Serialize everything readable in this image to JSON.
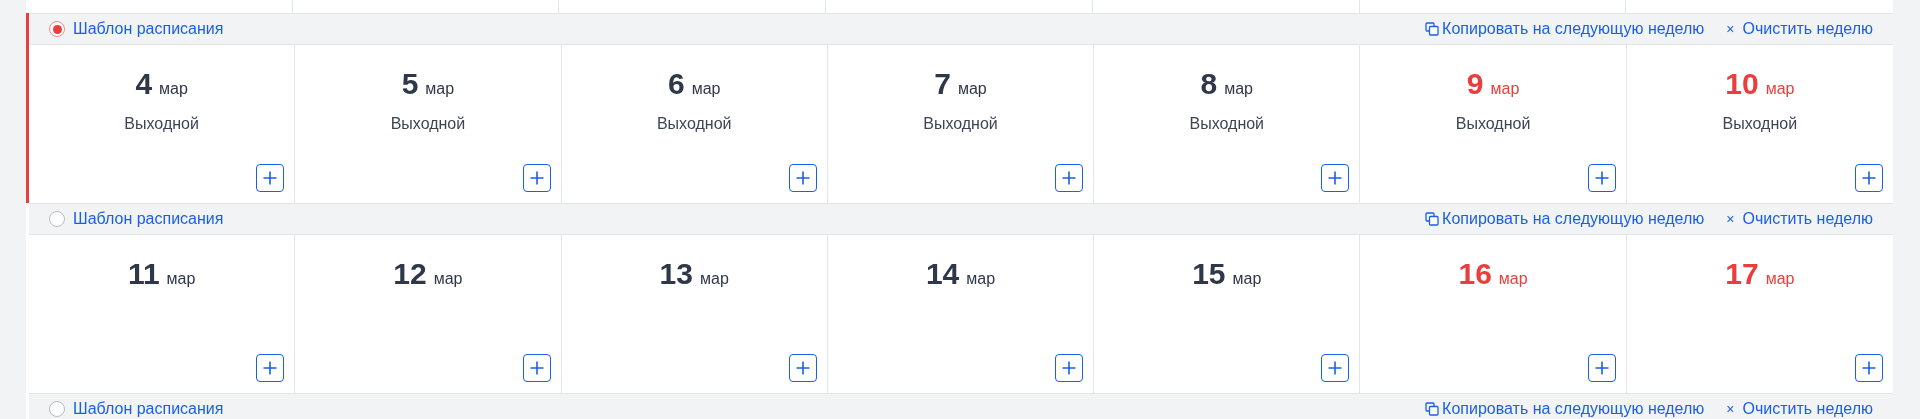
{
  "weeks": [
    {
      "selected": true,
      "template_label": "Шаблон расписания",
      "copy_label": "Копировать на следующую неделю",
      "clear_mark": "×",
      "clear_label": "Очистить неделю",
      "days": [
        {
          "day": "4",
          "month": "мар",
          "weekend": false,
          "note": "Выходной"
        },
        {
          "day": "5",
          "month": "мар",
          "weekend": false,
          "note": "Выходной"
        },
        {
          "day": "6",
          "month": "мар",
          "weekend": false,
          "note": "Выходной"
        },
        {
          "day": "7",
          "month": "мар",
          "weekend": false,
          "note": "Выходной"
        },
        {
          "day": "8",
          "month": "мар",
          "weekend": false,
          "note": "Выходной"
        },
        {
          "day": "9",
          "month": "мар",
          "weekend": true,
          "note": "Выходной"
        },
        {
          "day": "10",
          "month": "мар",
          "weekend": true,
          "note": "Выходной"
        }
      ]
    },
    {
      "selected": false,
      "template_label": "Шаблон расписания",
      "copy_label": "Копировать на следующую неделю",
      "clear_mark": "×",
      "clear_label": "Очистить неделю",
      "days": [
        {
          "day": "11",
          "month": "мар",
          "weekend": false
        },
        {
          "day": "12",
          "month": "мар",
          "weekend": false
        },
        {
          "day": "13",
          "month": "мар",
          "weekend": false
        },
        {
          "day": "14",
          "month": "мар",
          "weekend": false
        },
        {
          "day": "15",
          "month": "мар",
          "weekend": false
        },
        {
          "day": "16",
          "month": "мар",
          "weekend": true
        },
        {
          "day": "17",
          "month": "мар",
          "weekend": true
        }
      ]
    },
    {
      "selected": false,
      "template_label": "Шаблон расписания",
      "copy_label": "Копировать на следующую неделю",
      "clear_mark": "×",
      "clear_label": "Очистить неделю"
    }
  ]
}
